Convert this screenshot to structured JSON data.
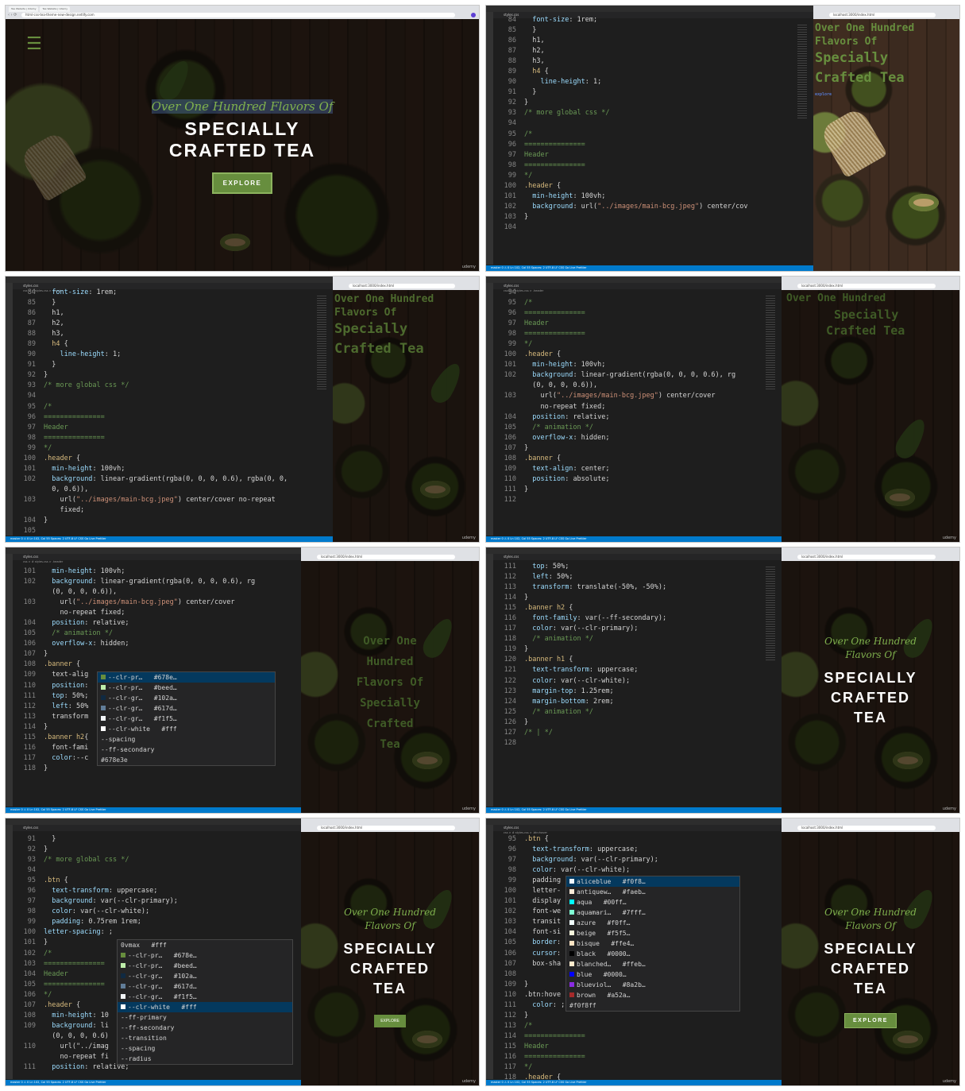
{
  "browser": {
    "tabs": [
      "Tea Website | Udemy",
      "Tea Website | Udemy"
    ],
    "url_live": "html-css-tea-theme-new-design.netlify.com",
    "url_local": "localhost:3000/index.html"
  },
  "site": {
    "script_title": "Over One Hundred Flavors Of",
    "heading_lines": [
      "SPECIALLY",
      "CRAFTED TEA"
    ],
    "heading_stacked": [
      "SPECIALLY",
      "CRAFTED",
      "TEA"
    ],
    "button": "EXPLORE",
    "button_small": "explore",
    "early_script": [
      "Over One Hundred",
      "Flavors Of"
    ],
    "early_heading": [
      "Specially",
      "Crafted Tea"
    ],
    "narrow_lines": [
      "Over One",
      "Hundred",
      "Flavors Of",
      "Specially",
      "Crafted",
      "Tea"
    ],
    "menu_glyph": "☰",
    "watermark": "udemy"
  },
  "editor": {
    "file_tab": "styles.css",
    "crumb_header": "css > # styles.css > .header",
    "crumb_btn": "css > # styles.css > .btn:hover",
    "status": "master  0 ⚠ 0   Ln 102, Col 55  Spaces: 2  UTF-8  LF  CSS  Go Live  Prettier"
  },
  "code": {
    "p2": [
      [
        "84",
        "  font-size: 1rem;"
      ],
      [
        "85",
        "  }"
      ],
      [
        "86",
        "  h1,"
      ],
      [
        "87",
        "  h2,"
      ],
      [
        "88",
        "  h3,"
      ],
      [
        "89",
        "  h4 {"
      ],
      [
        "90",
        "    line-height: 1;"
      ],
      [
        "91",
        "  }"
      ],
      [
        "92",
        "}"
      ],
      [
        "93",
        "/* more global css */"
      ],
      [
        "94",
        ""
      ],
      [
        "95",
        "/*"
      ],
      [
        "96",
        "==============="
      ],
      [
        "97",
        "Header"
      ],
      [
        "98",
        "==============="
      ],
      [
        "99",
        "*/"
      ],
      [
        "100",
        ".header {"
      ],
      [
        "101",
        "  min-height: 100vh;"
      ],
      [
        "102",
        "  background: url(\"../images/main-bcg.jpeg\") center/cov"
      ],
      [
        "103",
        "}"
      ],
      [
        "104",
        ""
      ]
    ],
    "p3": [
      [
        "84",
        "  font-size: 1rem;"
      ],
      [
        "85",
        "  }"
      ],
      [
        "86",
        "  h1,"
      ],
      [
        "87",
        "  h2,"
      ],
      [
        "88",
        "  h3,"
      ],
      [
        "89",
        "  h4 {"
      ],
      [
        "90",
        "    line-height: 1;"
      ],
      [
        "91",
        "  }"
      ],
      [
        "92",
        "}"
      ],
      [
        "93",
        "/* more global css */"
      ],
      [
        "94",
        ""
      ],
      [
        "95",
        "/*"
      ],
      [
        "96",
        "==============="
      ],
      [
        "97",
        "Header"
      ],
      [
        "98",
        "==============="
      ],
      [
        "99",
        "*/"
      ],
      [
        "100",
        ".header {"
      ],
      [
        "101",
        "  min-height: 100vh;"
      ],
      [
        "102",
        "  background: linear-gradient(rgba(0, 0, 0, 0.6), rgba(0, 0,"
      ],
      [
        "",
        "  0, 0.6)),"
      ],
      [
        "103",
        "    url(\"../images/main-bcg.jpeg\") center/cover no-repeat"
      ],
      [
        "",
        "    fixed;"
      ],
      [
        "104",
        "}"
      ],
      [
        "105",
        ""
      ]
    ],
    "p4": [
      [
        "94",
        ""
      ],
      [
        "95",
        "/*"
      ],
      [
        "96",
        "==============="
      ],
      [
        "97",
        "Header"
      ],
      [
        "98",
        "==============="
      ],
      [
        "99",
        "*/"
      ],
      [
        "100",
        ".header {"
      ],
      [
        "101",
        "  min-height: 100vh;"
      ],
      [
        "102",
        "  background: linear-gradient(rgba(0, 0, 0, 0.6), rg"
      ],
      [
        "",
        "  (0, 0, 0, 0.6)),"
      ],
      [
        "103",
        "    url(\"../images/main-bcg.jpeg\") center/cover"
      ],
      [
        "",
        "    no-repeat fixed;"
      ],
      [
        "104",
        "  position: relative;"
      ],
      [
        "105",
        "  /* animation */"
      ],
      [
        "106",
        "  overflow-x: hidden;"
      ],
      [
        "107",
        "}"
      ],
      [
        "108",
        ".banner {"
      ],
      [
        "109",
        "  text-align: center;"
      ],
      [
        "110",
        "  position: absolute;"
      ],
      [
        "111",
        "}"
      ],
      [
        "112",
        ""
      ]
    ],
    "p5": [
      [
        "101",
        "  min-height: 100vh;"
      ],
      [
        "102",
        "  background: linear-gradient(rgba(0, 0, 0, 0.6), rg"
      ],
      [
        "",
        "  (0, 0, 0, 0.6)),"
      ],
      [
        "103",
        "    url(\"../images/main-bcg.jpeg\") center/cover"
      ],
      [
        "",
        "    no-repeat fixed;"
      ],
      [
        "104",
        "  position: relative;"
      ],
      [
        "105",
        "  /* animation */"
      ],
      [
        "106",
        "  overflow-x: hidden;"
      ],
      [
        "107",
        "}"
      ],
      [
        "108",
        ".banner {"
      ],
      [
        "109",
        "  text-alig"
      ],
      [
        "110",
        "  position:"
      ],
      [
        "111",
        "  top: 50%;"
      ],
      [
        "112",
        "  left: 50%"
      ],
      [
        "113",
        "  transform"
      ],
      [
        "114",
        "}"
      ],
      [
        "115",
        ".banner h2{"
      ],
      [
        "116",
        "  font-fami"
      ],
      [
        "117",
        "  color:--c"
      ],
      [
        "118",
        "}"
      ]
    ],
    "p6": [
      [
        "111",
        "  top: 50%;"
      ],
      [
        "112",
        "  left: 50%;"
      ],
      [
        "113",
        "  transform: translate(-50%, -50%);"
      ],
      [
        "114",
        "}"
      ],
      [
        "115",
        ".banner h2 {"
      ],
      [
        "116",
        "  font-family: var(--ff-secondary);"
      ],
      [
        "117",
        "  color: var(--clr-primary);"
      ],
      [
        "118",
        "  /* animation */"
      ],
      [
        "119",
        "}"
      ],
      [
        "120",
        ".banner h1 {"
      ],
      [
        "121",
        "  text-transform: uppercase;"
      ],
      [
        "122",
        "  color: var(--clr-white);"
      ],
      [
        "123",
        "  margin-top: 1.25rem;"
      ],
      [
        "124",
        "  margin-bottom: 2rem;"
      ],
      [
        "125",
        "  /* animation */"
      ],
      [
        "126",
        "}"
      ],
      [
        "127",
        "/* | */"
      ],
      [
        "128",
        ""
      ]
    ],
    "p7": [
      [
        "91",
        "  }"
      ],
      [
        "92",
        "}"
      ],
      [
        "93",
        "/* more global css */"
      ],
      [
        "94",
        ""
      ],
      [
        "95",
        ".btn {"
      ],
      [
        "96",
        "  text-transform: uppercase;"
      ],
      [
        "97",
        "  background: var(--clr-primary);"
      ],
      [
        "98",
        "  color: var(--clr-white);"
      ],
      [
        "99",
        "  padding: 0.75rem 1rem;"
      ],
      [
        "100",
        "letter-spacing: ;"
      ],
      [
        "101",
        "}"
      ],
      [
        "102",
        "/*"
      ],
      [
        "103",
        "==============="
      ],
      [
        "104",
        "Header"
      ],
      [
        "105",
        "==============="
      ],
      [
        "106",
        "*/"
      ],
      [
        "107",
        ".header {"
      ],
      [
        "108",
        "  min-height: 10"
      ],
      [
        "109",
        "  background: li"
      ],
      [
        "",
        "  (0, 0, 0, 0.6)"
      ],
      [
        "110",
        "    url(\"../imag"
      ],
      [
        "",
        "    no-repeat fi"
      ],
      [
        "111",
        "  position: relative;"
      ]
    ],
    "p8": [
      [
        "95",
        ".btn {"
      ],
      [
        "96",
        "  text-transform: uppercase;"
      ],
      [
        "97",
        "  background: var(--clr-primary);"
      ],
      [
        "98",
        "  color: var(--clr-white);"
      ],
      [
        "99",
        "  padding"
      ],
      [
        "100",
        "  letter-"
      ],
      [
        "101",
        "  display"
      ],
      [
        "102",
        "  font-we"
      ],
      [
        "103",
        "  transit"
      ],
      [
        "104",
        "  font-si"
      ],
      [
        "105",
        "  border:"
      ],
      [
        "106",
        "  cursor:"
      ],
      [
        "107",
        "  box-sha"
      ],
      [
        "108",
        ""
      ],
      [
        "109",
        "}"
      ],
      [
        "110",
        ".btn:hove"
      ],
      [
        "111",
        "  color: ;"
      ],
      [
        "112",
        "}"
      ],
      [
        "113",
        "/*"
      ],
      [
        "114",
        "==============="
      ],
      [
        "115",
        "Header"
      ],
      [
        "116",
        "==============="
      ],
      [
        "117",
        "*/"
      ],
      [
        "118",
        ".header {"
      ]
    ]
  },
  "suggestions": {
    "vars": [
      {
        "name": "--clr-pr…",
        "value": "#678e…",
        "color": "#678e3e"
      },
      {
        "name": "--clr-pr…",
        "value": "#beed…",
        "color": "#beedaa"
      },
      {
        "name": "--clr-gr…",
        "value": "#102a…",
        "color": "#102a42"
      },
      {
        "name": "--clr-gr…",
        "value": "#617d…",
        "color": "#617d98"
      },
      {
        "name": "--clr-gr…",
        "value": "#f1f5…",
        "color": "#f1f5f8"
      },
      {
        "name": "--clr-white",
        "value": "#fff",
        "color": "#ffffff"
      },
      {
        "name": "--spacing",
        "value": ""
      },
      {
        "name": "--ff-secondary",
        "value": ""
      }
    ],
    "p5_detail": "#678e3e",
    "p7_first": "0vmax",
    "p7_detail": "#fff",
    "p7_tail": [
      "--ff-primary",
      "--ff-secondary",
      "--transition",
      "--spacing",
      "--radius"
    ],
    "colors": [
      {
        "name": "aliceblue",
        "value": "#f0f8…",
        "color": "#f0f8ff"
      },
      {
        "name": "antiquew…",
        "value": "#faeb…",
        "color": "#faebd7"
      },
      {
        "name": "aqua",
        "value": "#00ff…",
        "color": "#00ffff"
      },
      {
        "name": "aquamari…",
        "value": "#7fff…",
        "color": "#7fffd4"
      },
      {
        "name": "azure",
        "value": "#f0ff…",
        "color": "#f0ffff"
      },
      {
        "name": "beige",
        "value": "#f5f5…",
        "color": "#f5f5dc"
      },
      {
        "name": "bisque",
        "value": "#ffe4…",
        "color": "#ffe4c4"
      },
      {
        "name": "black",
        "value": "#0000…",
        "color": "#000000"
      },
      {
        "name": "blanched…",
        "value": "#ffeb…",
        "color": "#ffebcd"
      },
      {
        "name": "blue",
        "value": "#0000…",
        "color": "#0000ff"
      },
      {
        "name": "blueviol…",
        "value": "#8a2b…",
        "color": "#8a2be2"
      },
      {
        "name": "brown",
        "value": "#a52a…",
        "color": "#a52a2a"
      }
    ],
    "p8_detail": "#f0f8ff"
  }
}
